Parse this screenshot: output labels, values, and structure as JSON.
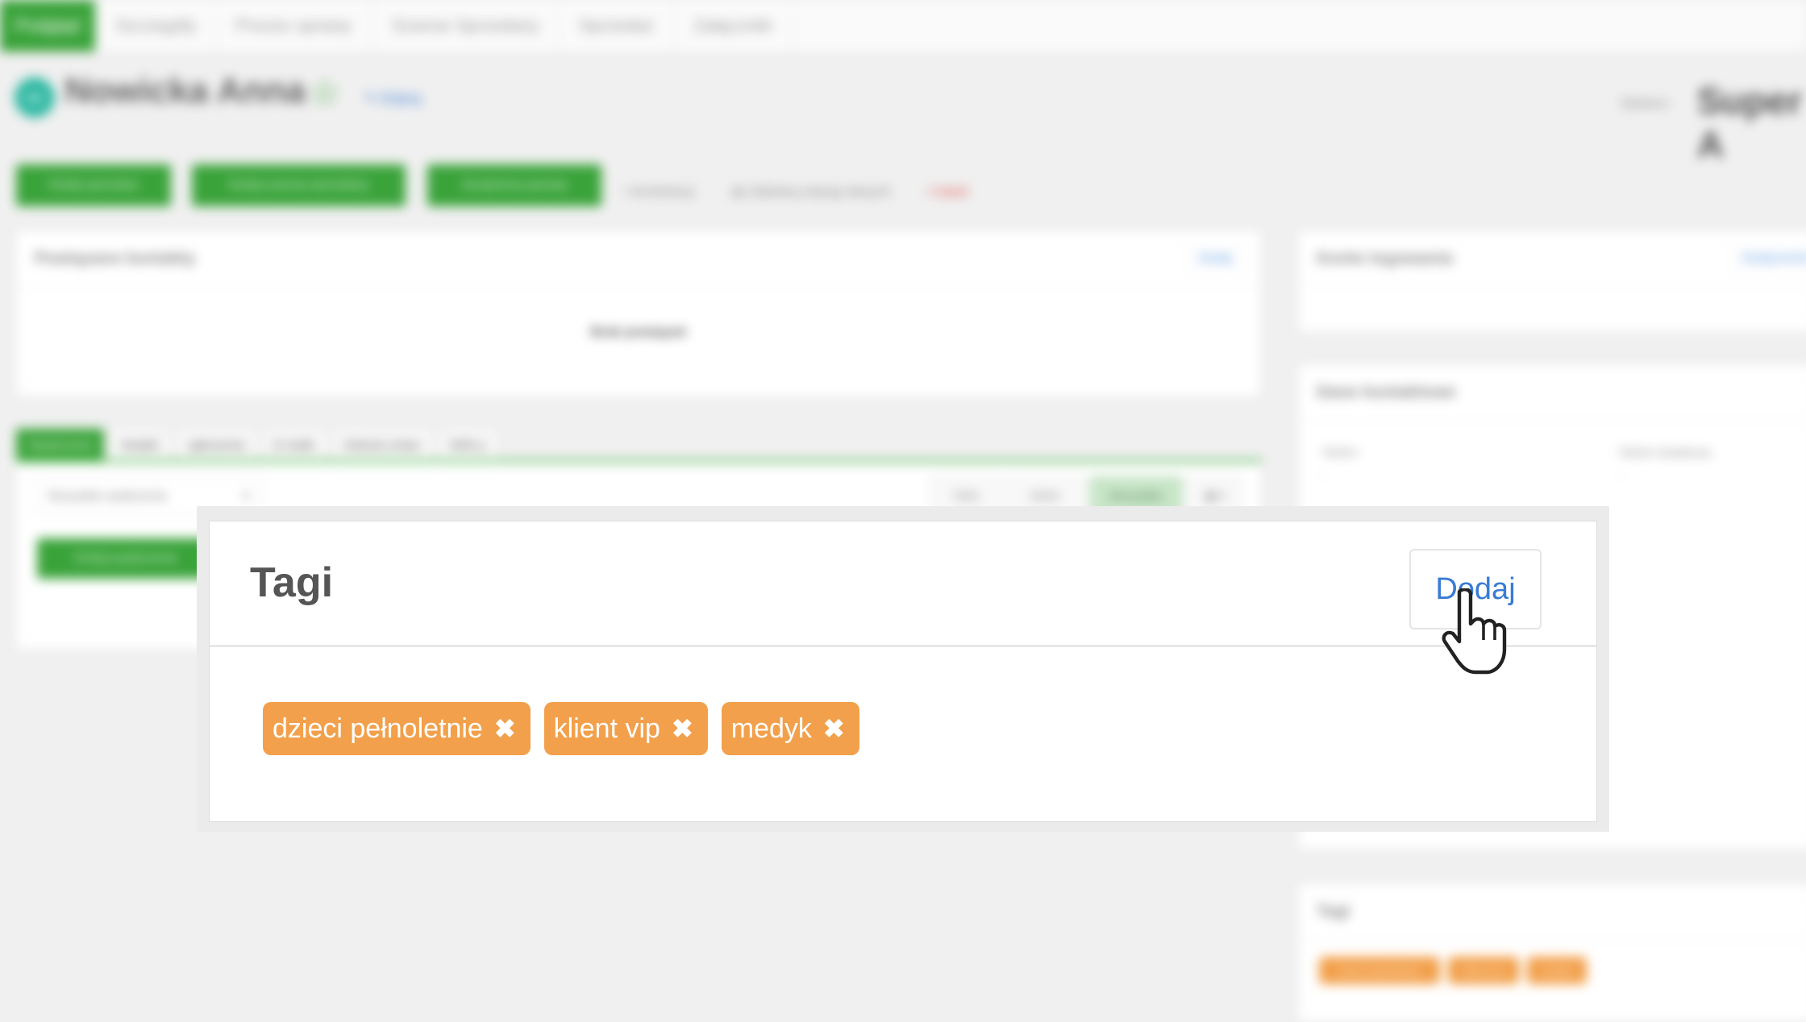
{
  "tabs": [
    "Podgląd",
    "Szczegóły",
    "Proces sprawy",
    "Szanse Sprzedaży",
    "Sprzedaż",
    "Załączniki"
  ],
  "contact": {
    "initials": "NA",
    "name": "Nowicka Anna",
    "edit_label": "Edytuj"
  },
  "owner": {
    "label": "Opiekun",
    "value": "Super A"
  },
  "actions": {
    "buttons": [
      "Dodaj sprzedaż",
      "Dodaj szansę sprzedaży",
      "Zarejestruj sprawę"
    ],
    "links": [
      "Archiwizuj",
      "Zablokuj edycję danych",
      "Usuń"
    ]
  },
  "related": {
    "title": "Powiązane kontakty",
    "add_label": "Dodaj",
    "empty_text": "Brak powiązań"
  },
  "login": {
    "title": "Konto logowania",
    "add_label": "Dodaj konto"
  },
  "contact_data": {
    "title": "Dane kontaktowe",
    "phone_label": "Telefon",
    "phone_value": "-",
    "phone2_label": "Telefon dodatkowy",
    "phone2_value": "-"
  },
  "activity": {
    "tabs": [
      "Wydarzenia",
      "Notatki",
      "zgłoszenia",
      "E-maile",
      "Historia zmian",
      "SMS-y"
    ],
    "filter_value": "Wszystkie wydarzenia",
    "filters": [
      "Tylko",
      "Wiele",
      "Wszystkie"
    ],
    "add_event_label": "Dodaj wydarzenie"
  },
  "tags_small": {
    "title": "Tagi"
  },
  "modal": {
    "title": "Tagi",
    "add_label": "Dodaj",
    "tags": [
      "dzieci pełnoletnie",
      "klient vip",
      "medyk"
    ]
  },
  "colors": {
    "green": "#3aa33a",
    "tag_orange": "#f2a04b",
    "link_blue": "#3a7bd5"
  }
}
